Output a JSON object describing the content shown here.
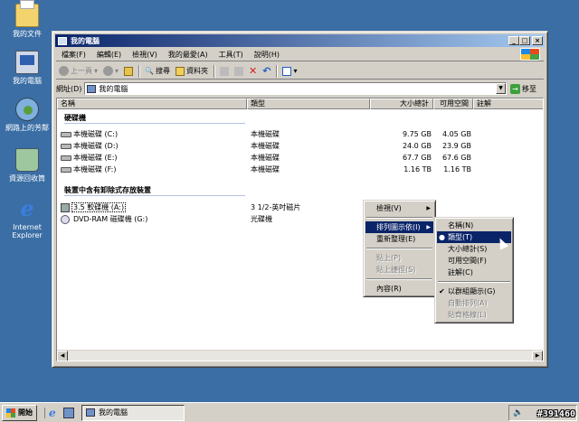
{
  "desktop": {
    "icons": [
      {
        "label": "我的文件",
        "icon": "my-documents-icon"
      },
      {
        "label": "我的電腦",
        "icon": "my-computer-icon"
      },
      {
        "label": "網路上的芳鄰",
        "icon": "network-places-icon"
      },
      {
        "label": "資源回收筒",
        "icon": "recycle-bin-icon"
      },
      {
        "label": "Internet Explorer",
        "icon": "internet-explorer-icon"
      }
    ]
  },
  "window": {
    "title": "我的電腦",
    "menu": [
      "檔案(F)",
      "編輯(E)",
      "檢視(V)",
      "我的最愛(A)",
      "工具(T)",
      "說明(H)"
    ],
    "toolbar": {
      "back": "上一頁",
      "search": "搜尋",
      "folders": "資料夾"
    },
    "address": {
      "label": "網址(D)",
      "value": "我的電腦",
      "go": "移至"
    },
    "columns": [
      "名稱",
      "類型",
      "大小總計",
      "可用空間",
      "註解"
    ],
    "groups": [
      {
        "title": "硬碟機",
        "items": [
          {
            "name": "本機磁碟 (C:)",
            "type": "本機磁碟",
            "total": "9.75 GB",
            "free": "4.05 GB"
          },
          {
            "name": "本機磁碟 (D:)",
            "type": "本機磁碟",
            "total": "24.0 GB",
            "free": "23.9 GB"
          },
          {
            "name": "本機磁碟 (E:)",
            "type": "本機磁碟",
            "total": "67.7 GB",
            "free": "67.6 GB"
          },
          {
            "name": "本機磁碟 (F:)",
            "type": "本機磁碟",
            "total": "1.16 TB",
            "free": "1.16 TB"
          }
        ]
      },
      {
        "title": "裝置中含有卸除式存放裝置",
        "items": [
          {
            "name": "3.5 軟碟機 (A:)",
            "type": "3 1/2-英吋磁片",
            "total": "",
            "free": ""
          },
          {
            "name": "DVD-RAM 磁碟機 (G:)",
            "type": "光碟機",
            "total": "",
            "free": ""
          }
        ]
      }
    ]
  },
  "context_menu": {
    "items": [
      "檢視(V)",
      "排列圖示依(I)",
      "重新整理(E)",
      "貼上(P)",
      "貼上捷徑(S)",
      "內容(R)"
    ]
  },
  "submenu": {
    "items": [
      "名稱(N)",
      "類型(T)",
      "大小總計(S)",
      "可用空間(F)",
      "註解(C)",
      "以群組顯示(G)",
      "自動排列(A)",
      "貼齊格線(L)"
    ]
  },
  "taskbar": {
    "start": "開始",
    "task": "我的電腦"
  },
  "watermark": "#391460"
}
